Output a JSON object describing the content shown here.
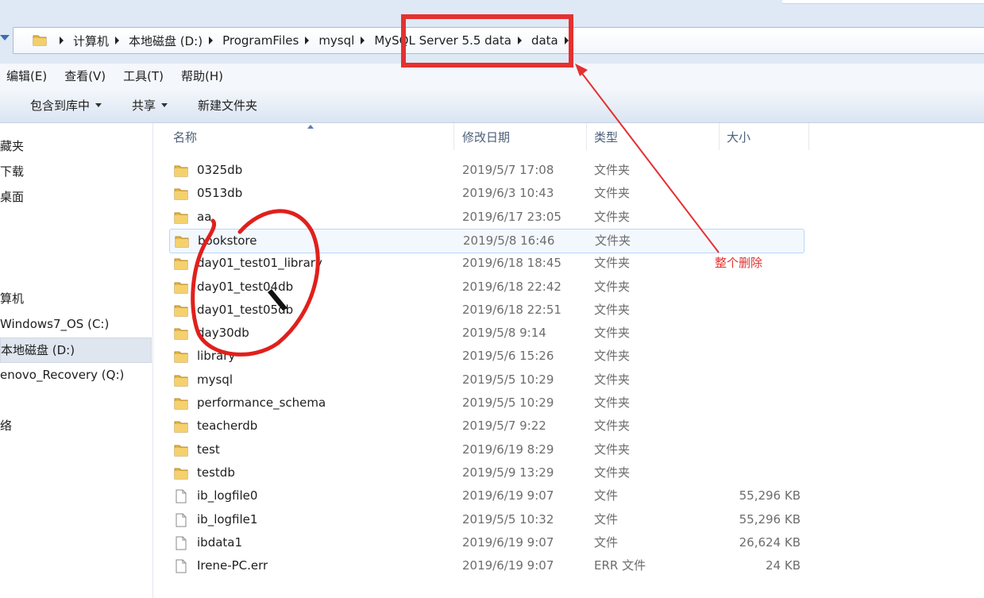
{
  "address": {
    "crumbs": [
      "计算机",
      "本地磁盘 (D:)",
      "ProgramFiles",
      "mysql",
      "MySQL Server 5.5 data",
      "data"
    ]
  },
  "menu": [
    "编辑(E)",
    "查看(V)",
    "工具(T)",
    "帮助(H)"
  ],
  "toolbar": {
    "include_library": "包含到库中",
    "share": "共享",
    "new_folder": "新建文件夹"
  },
  "nav": [
    "藏夹",
    "下载",
    "桌面",
    "算机",
    "Windows7_OS (C:)",
    "本地磁盘 (D:)",
    "enovo_Recovery (Q:)",
    "络"
  ],
  "columns": {
    "name": "名称",
    "date": "修改日期",
    "type": "类型",
    "size": "大小"
  },
  "files": [
    {
      "name": "0325db",
      "date": "2019/5/7 17:08",
      "type": "文件夹",
      "size": "",
      "kind": "folder"
    },
    {
      "name": "0513db",
      "date": "2019/6/3 10:43",
      "type": "文件夹",
      "size": "",
      "kind": "folder"
    },
    {
      "name": "aa",
      "date": "2019/6/17 23:05",
      "type": "文件夹",
      "size": "",
      "kind": "folder"
    },
    {
      "name": "bookstore",
      "date": "2019/5/8 16:46",
      "type": "文件夹",
      "size": "",
      "kind": "folder"
    },
    {
      "name": "day01_test01_library",
      "date": "2019/6/18 18:45",
      "type": "文件夹",
      "size": "",
      "kind": "folder"
    },
    {
      "name": "day01_test04db",
      "date": "2019/6/18 22:42",
      "type": "文件夹",
      "size": "",
      "kind": "folder"
    },
    {
      "name": "day01_test05db",
      "date": "2019/6/18 22:51",
      "type": "文件夹",
      "size": "",
      "kind": "folder"
    },
    {
      "name": "day30db",
      "date": "2019/5/8 9:14",
      "type": "文件夹",
      "size": "",
      "kind": "folder"
    },
    {
      "name": "library",
      "date": "2019/5/6 15:26",
      "type": "文件夹",
      "size": "",
      "kind": "folder"
    },
    {
      "name": "mysql",
      "date": "2019/5/5 10:29",
      "type": "文件夹",
      "size": "",
      "kind": "folder"
    },
    {
      "name": "performance_schema",
      "date": "2019/5/5 10:29",
      "type": "文件夹",
      "size": "",
      "kind": "folder"
    },
    {
      "name": "teacherdb",
      "date": "2019/5/7 9:22",
      "type": "文件夹",
      "size": "",
      "kind": "folder"
    },
    {
      "name": "test",
      "date": "2019/6/19 8:29",
      "type": "文件夹",
      "size": "",
      "kind": "folder"
    },
    {
      "name": "testdb",
      "date": "2019/5/9 13:29",
      "type": "文件夹",
      "size": "",
      "kind": "folder"
    },
    {
      "name": "ib_logfile0",
      "date": "2019/6/19 9:07",
      "type": "文件",
      "size": "55,296 KB",
      "kind": "file"
    },
    {
      "name": "ib_logfile1",
      "date": "2019/5/5 10:32",
      "type": "文件",
      "size": "55,296 KB",
      "kind": "file"
    },
    {
      "name": "ibdata1",
      "date": "2019/6/19 9:07",
      "type": "文件",
      "size": "26,624 KB",
      "kind": "file"
    },
    {
      "name": "Irene-PC.err",
      "date": "2019/6/19 9:07",
      "type": "ERR 文件",
      "size": "24 KB",
      "kind": "file"
    }
  ],
  "annotation": {
    "label": "整个删除",
    "color": "#e53030"
  }
}
